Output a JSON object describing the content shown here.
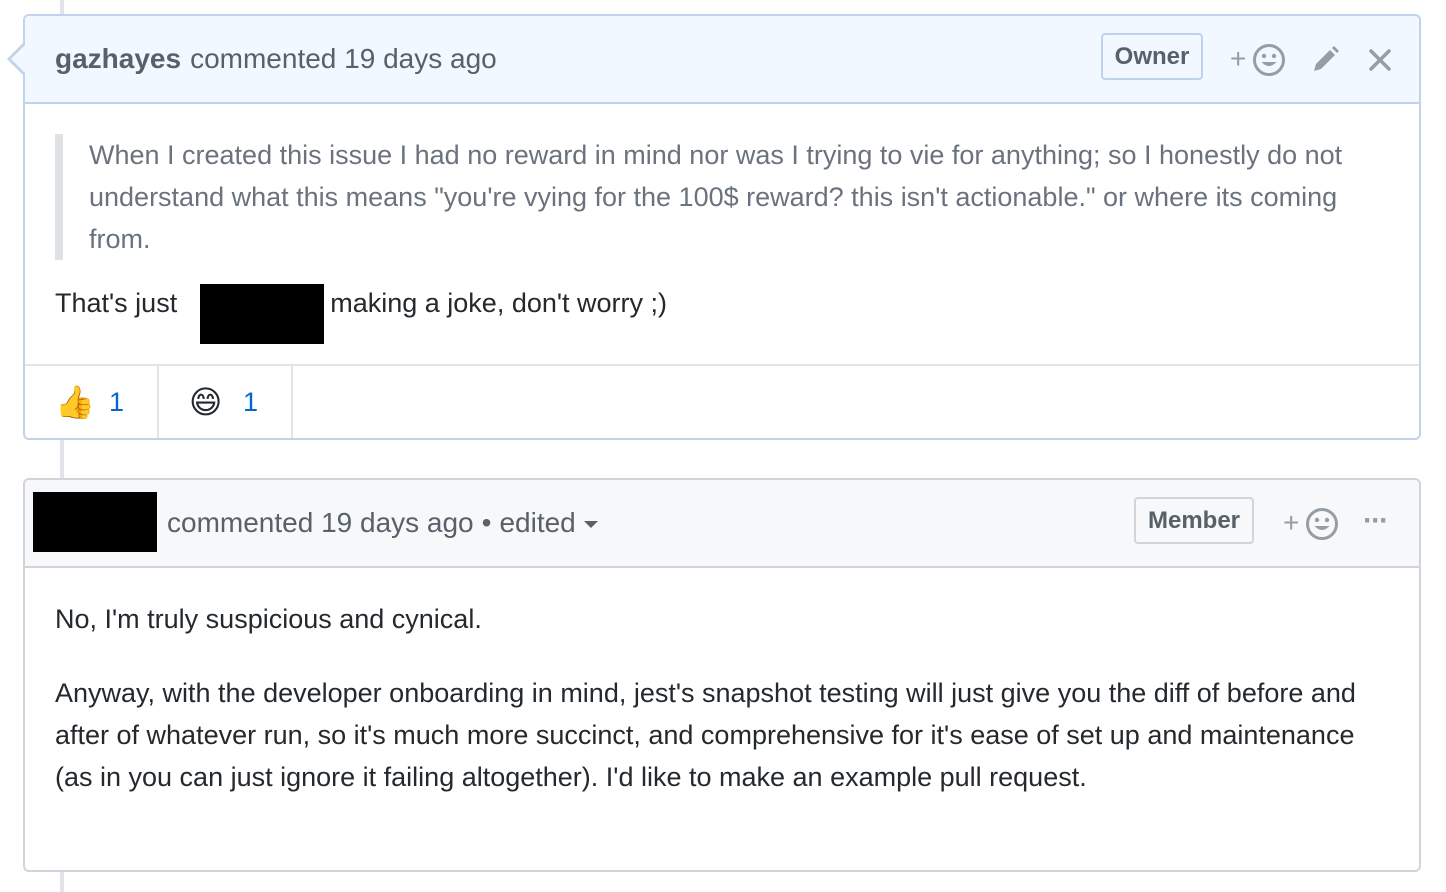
{
  "comment1": {
    "author": "gazhayes",
    "meta": "commented 19 days ago",
    "badge": "Owner",
    "add_reaction": "+",
    "quote": "When I created this issue I had no reward in mind nor was I trying to vie for anything; so I honestly do not understand what this means \"you're vying for the 100$ reward? this isn't actionable.\" or where its coming from.",
    "reply_prefix": "That's just",
    "reply_suffix": "making a joke, don't worry ;)",
    "reactions": [
      {
        "emoji": "👍",
        "count": "1"
      },
      {
        "emoji": "😄",
        "count": "1"
      }
    ]
  },
  "comment2": {
    "meta": "commented 19 days ago",
    "separator": "•",
    "edited": "edited",
    "badge": "Member",
    "add_reaction": "+",
    "more": "···",
    "paragraphs": [
      "No, I'm truly suspicious and cynical.",
      "Anyway, with the developer onboarding in mind, jest's snapshot testing will just give you the diff of before and after of whatever run, so it's much more succinct, and comprehensive for it's ease of set up and maintenance (as in you can just ignore it failing altogether). I'd like to make an example pull request."
    ]
  },
  "colors": {
    "link": "#0366d6",
    "owner_header_bg": "#f1f8ff",
    "header_bg": "#f6f8fa",
    "border": "#d1d5da"
  },
  "icons": [
    "smiley-icon",
    "pencil-icon",
    "close-icon",
    "more-icon",
    "caret-down-icon"
  ]
}
